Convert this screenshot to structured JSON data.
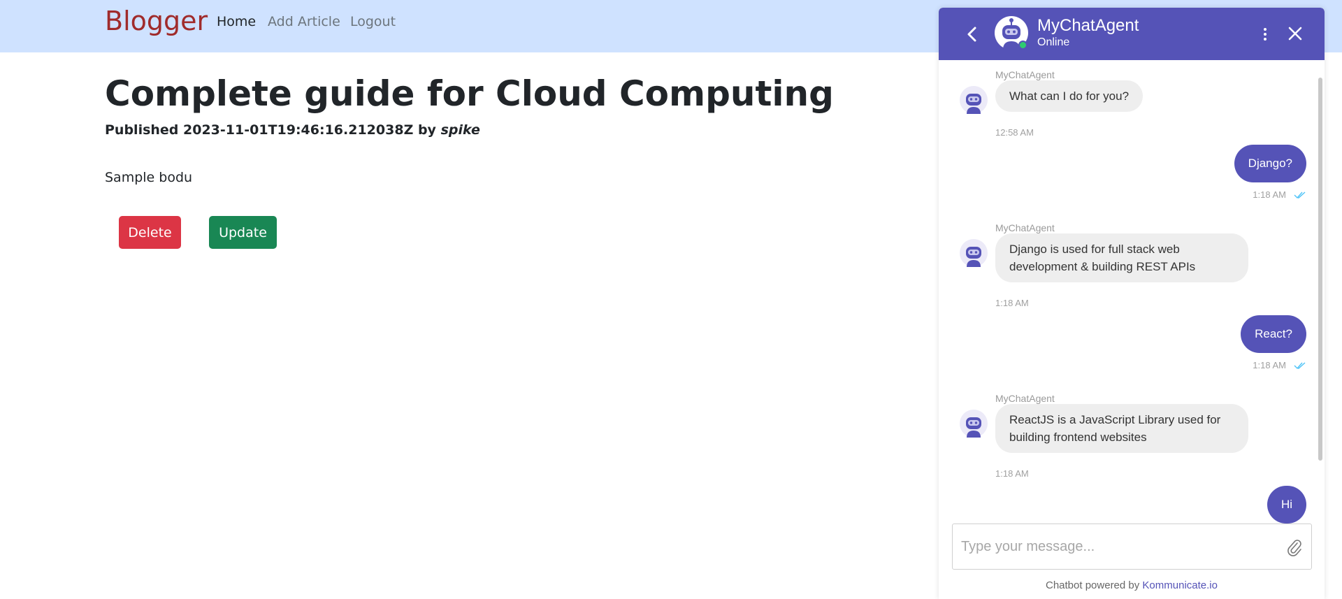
{
  "navbar": {
    "brand": "Blogger",
    "links": [
      "Home",
      "Add Article",
      "Logout"
    ]
  },
  "article": {
    "title": "Complete guide for Cloud Computing",
    "published_prefix": "Published 2023-11-01T19:46:16.212038Z by ",
    "author": "spike",
    "body": "Sample bodu",
    "delete_label": "Delete",
    "update_label": "Update"
  },
  "chat": {
    "agent_name": "MyChatAgent",
    "status": "Online",
    "messages": [
      {
        "from": "bot",
        "sender": "MyChatAgent",
        "text": "What can I do for you?",
        "time": "12:58 AM"
      },
      {
        "from": "user",
        "text": "Django?",
        "time": "1:18 AM"
      },
      {
        "from": "bot",
        "sender": "MyChatAgent",
        "text": "Django is used for full stack web development & building REST APIs",
        "time": "1:18 AM"
      },
      {
        "from": "user",
        "text": "React?",
        "time": "1:18 AM"
      },
      {
        "from": "bot",
        "sender": "MyChatAgent",
        "text": "ReactJS is a JavaScript Library used for building frontend websites",
        "time": "1:18 AM"
      },
      {
        "from": "user",
        "text": "Hi"
      }
    ],
    "input_placeholder": "Type your message...",
    "powered_prefix": "Chatbot powered by ",
    "powered_link": "Kommunicate.io",
    "accent_color": "#5553b7",
    "online_color": "#2ecc71"
  }
}
